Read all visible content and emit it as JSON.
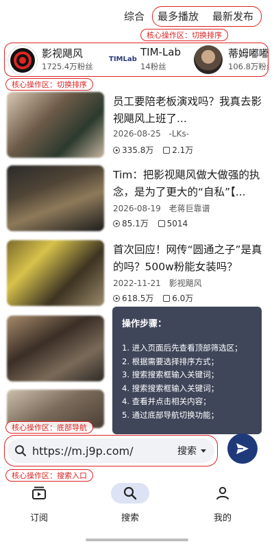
{
  "sort_tabs": [
    {
      "label": "综合"
    },
    {
      "label": "最多播放"
    },
    {
      "label": "最新发布"
    }
  ],
  "annotations": {
    "sort_area": "核心操作区：切换排序",
    "creator_area": "核心操作区：切换排序",
    "bottom_nav_area": "核心操作区：底部导航",
    "search_area": "核心操作区：搜索入口"
  },
  "creators": [
    {
      "name": "影视飓风",
      "fans": "1725.4万粉丝",
      "avatar": "red-ring-logo"
    },
    {
      "name": "TIM-Lab",
      "fans": "14粉丝",
      "logo_text": "TIMLab"
    },
    {
      "name": "蒂姆嘟嘟",
      "fans": "106.8万粉丝",
      "avatar": "photo"
    }
  ],
  "videos": [
    {
      "title": "员工要陪老板演戏吗？我真去影视飓风上班了...",
      "date": "2026-08-25",
      "author": "-LKs-",
      "plays": "335.8万",
      "comments": "2.1万"
    },
    {
      "title": "Tim：把影视飓风做大做强的执念，是为了更大的“自私”【...",
      "date": "2026-08-19",
      "author": "老蒋巨靠谱",
      "plays": "85.1万",
      "comments": "5014"
    },
    {
      "title": "首次回应！网传“圆通之子”是真的吗？500w粉能女装吗？",
      "date": "2022-11-21",
      "author": "影视飓风",
      "plays": "618.5万",
      "comments": "6.0万"
    },
    {
      "title": "",
      "date": "",
      "author": "",
      "plays": "",
      "comments": ""
    },
    {
      "title": "",
      "date": "",
      "author": "",
      "plays": "",
      "comments": ""
    }
  ],
  "steps_panel": {
    "title": "操作步骤：",
    "steps": [
      "1. 进入页面后先查看顶部筛选区；",
      "2. 根据需要选择排序方式；",
      "3. 搜索搜索框输入关键词；",
      "4. 搜索搜索框输入关键词；",
      "4. 查看并点击相关内容；",
      "5. 通过底部导航切换功能；"
    ]
  },
  "search": {
    "value": "https://m.j9p.com/",
    "type_label": "搜索"
  },
  "bottom_nav": [
    {
      "label": "订阅",
      "icon": "subscription-icon"
    },
    {
      "label": "搜索",
      "icon": "search-icon",
      "active": true
    },
    {
      "label": "我的",
      "icon": "profile-icon"
    }
  ],
  "colors": {
    "annotation": "#dd2222",
    "send_button": "#1f3a7a",
    "steps_panel_bg": "#30384e",
    "nav_active_pill": "#dde3f4"
  }
}
